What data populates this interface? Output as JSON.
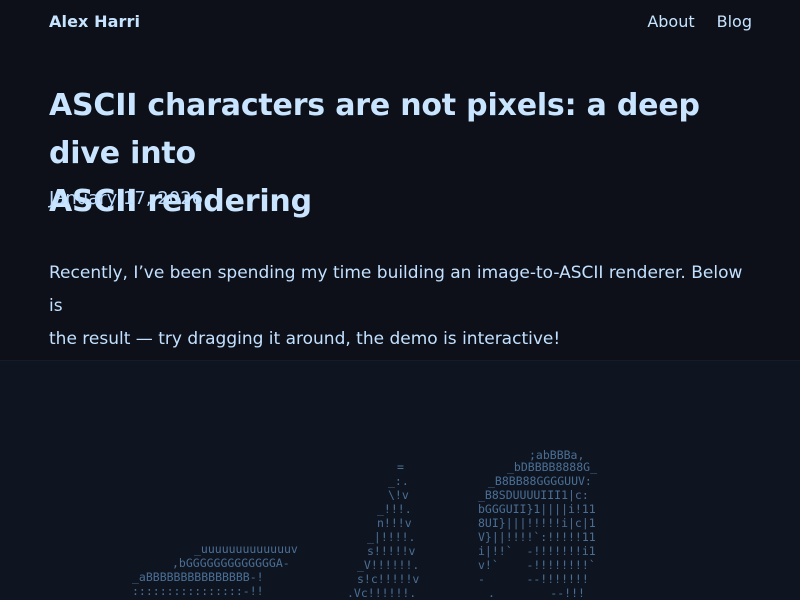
{
  "nav": {
    "site_title": "Alex Harri",
    "links": [
      {
        "label": "About"
      },
      {
        "label": "Blog"
      }
    ]
  },
  "article": {
    "title_line1": "ASCII characters are not pixels: a deep dive into",
    "title_line2": "ASCII rendering",
    "date": "January 17, 2026",
    "intro_line1": "Recently, I’ve been spending my time building an image-to-ASCII renderer. Below is",
    "intro_line2": "the result — try dragging it around, the demo is interactive!"
  },
  "ascii_demo": {
    "left_shape": [
      "_uuuuuuuuuuuuuv",
      ",bGGGGGGGGGGGGGA-",
      "_aBBBBBBBBBBBBBBB-!",
      "::::::::::::::::-!!"
    ],
    "middle_shape": [
      "=",
      "_:.",
      "\\!v",
      "_!!!.",
      "n!!!v",
      "_|!!!!.",
      "s!!!!!v",
      "_V!!!!!!.",
      "s!c!!!!!v",
      ".Vc!!!!!!."
    ],
    "right_shape": [
      ";abBBBa,",
      "_bDBBBB8888G_",
      "_B8BB88GGGGUUV:",
      "_B8SDUUUUIII1|c:",
      "bGGGUII}1||||i!11",
      "8UI}|||!!!!!i|c|1",
      "V}||!!!!`:!!!!!11",
      "i|!!`  -!!!!!!!i1",
      "v!`    -!!!!!!!!`",
      "-      --!!!!!!!",
      ".        --!!!"
    ]
  }
}
